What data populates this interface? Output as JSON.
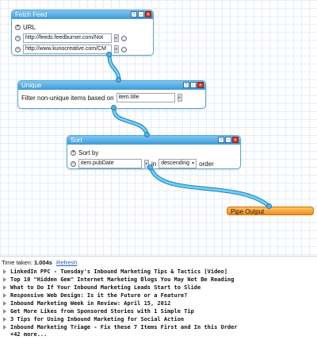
{
  "fetch_feed": {
    "title": "Fetch Feed",
    "url_label": "URL",
    "urls": [
      "http://feeds.feedburner.com/Not",
      "http://www.kunocreative.com/CM"
    ]
  },
  "unique": {
    "title": "Unique",
    "label": "Filter non-unique items based on",
    "field": "item.title"
  },
  "sort": {
    "title": "Sort",
    "sort_by_label": "Sort by",
    "field": "item.pubDate",
    "in_label": "in",
    "order_value": "descending",
    "order_label": "order"
  },
  "pipe_output": {
    "title": "Pipe Output"
  },
  "icons": {
    "help": "?",
    "minimize": "−",
    "close": "×",
    "add": "+",
    "remove": "−",
    "dropdown": "▾",
    "arrow": "▸"
  },
  "results": {
    "time_label": "Time taken:",
    "time_value": "1.004s",
    "refresh_label": "Refresh",
    "items": [
      "LinkedIn PPC - Tuesday's Inbound Marketing Tips & Tactics [Video]",
      "Top 10 \"Hidden Gem\" Internet Marketing Blogs You May Not Be Reading",
      "What to Do If Your Inbound Marketing Leads Start to Slide",
      "Responsive Web Design: Is it the Future or a Feature?",
      "Inbound Marketing Week in Review: April 15, 2012",
      "Get More Likes from Sponsored Stories with 1 Simple Tip",
      "3 Tips for Using Inbound Marketing for Social Action",
      "Inbound Marketing Triage - Fix these 7 Items First and In this Order"
    ],
    "more": "+42 more..."
  },
  "colors": {
    "module_header": "#3d9ad6",
    "wire": "#47b7ea",
    "output_header": "#f28e1c"
  }
}
